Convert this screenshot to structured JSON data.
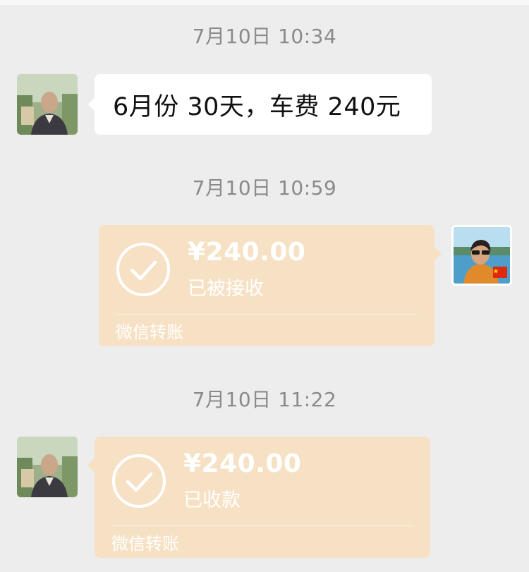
{
  "messages": [
    {
      "timestamp": "7月10日 10:34",
      "text": "6月份 30天，车费 240元"
    },
    {
      "timestamp": "7月10日 10:59",
      "transfer": {
        "amount": "¥240.00",
        "status": "已被接收",
        "label": "微信转账"
      }
    },
    {
      "timestamp": "7月10日 11:22",
      "transfer": {
        "amount": "¥240.00",
        "status": "已收款",
        "label": "微信转账"
      }
    }
  ],
  "colors": {
    "background": "#ededed",
    "transfer_bubble": "#f7e1c4",
    "text_bubble": "#ffffff",
    "timestamp": "#8a8a8a"
  },
  "icons": {
    "transfer_status": "check-circle-icon"
  }
}
